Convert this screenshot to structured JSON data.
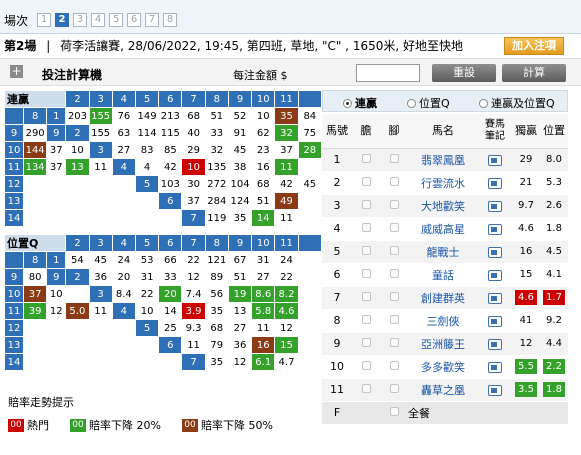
{
  "race_nav": {
    "label": "場次",
    "races": [
      "1",
      "2",
      "3",
      "4",
      "5",
      "6",
      "7",
      "8"
    ],
    "selected": "2"
  },
  "race_info": {
    "title": "第2場",
    "separator": "|",
    "details": "荷李活讓賽, 28/06/2022, 19:45, 第四班, 草地, \"C\" , 1650米, 好地至快地"
  },
  "add_button": "加入注項",
  "calc": {
    "title": "投注計算機",
    "amount_label": "每注金額 $",
    "amount_value": "",
    "reset": "重設",
    "compute": "計算"
  },
  "qin": {
    "corner": "連贏",
    "top_header": [
      "2",
      "3",
      "4",
      "5",
      "6",
      "7",
      "8",
      "9",
      "10",
      "11"
    ],
    "left_header": [
      "1",
      "2",
      "3",
      "4",
      "5",
      "6",
      "7",
      "8",
      "9",
      "10",
      "11",
      "12",
      "13",
      "14"
    ],
    "rows": [
      [
        "",
        "",
        "",
        "",
        "",
        "",
        "",
        "",
        "",
        "",
        ""
      ],
      [
        "203",
        "155",
        "76",
        "149",
        "213",
        "68",
        "51",
        "52",
        "10",
        "35",
        "84"
      ],
      [
        "290",
        "",
        "9",
        "2",
        "155",
        "63",
        "114",
        "115",
        "40",
        "33",
        "91"
      ],
      [
        "62",
        "",
        "",
        "",
        "32",
        "75",
        "",
        "",
        "",
        "",
        ""
      ],
      [
        "144",
        "37",
        "10",
        "",
        "3",
        "27",
        "83",
        "85",
        "29",
        "32",
        "45"
      ],
      [
        "23",
        "",
        "",
        "",
        "",
        "",
        "",
        "",
        "",
        "",
        ""
      ],
      [
        "134",
        "37",
        "13",
        "",
        "11",
        "",
        "4",
        "",
        "",
        "",
        ""
      ],
      [
        "",
        "",
        "",
        "",
        "",
        "",
        "",
        "",
        "",
        "",
        ""
      ]
    ],
    "display_rows": [
      {
        "label": "1",
        "cells": [
          {
            "v": "",
            "c": "dg"
          },
          {
            "v": "8",
            "c": "h"
          },
          {
            "v": "1",
            "c": "h"
          },
          {
            "v": "203",
            "c": ""
          },
          {
            "v": "155",
            "c": "g"
          },
          {
            "v": "76",
            "c": ""
          },
          {
            "v": "149",
            "c": ""
          },
          {
            "v": "213",
            "c": ""
          },
          {
            "v": "68",
            "c": ""
          },
          {
            "v": "51",
            "c": ""
          },
          {
            "v": "52",
            "c": ""
          },
          {
            "v": "10",
            "c": ""
          },
          {
            "v": "35",
            "c": "br"
          },
          {
            "v": "84",
            "c": ""
          }
        ]
      },
      {
        "label": "2",
        "cells": [
          {
            "v": "9",
            "c": "h"
          },
          {
            "v": "290",
            "c": ""
          },
          {
            "v": "9",
            "c": "h"
          },
          {
            "v": "2",
            "c": "h"
          },
          {
            "v": "155",
            "c": ""
          },
          {
            "v": "63",
            "c": ""
          },
          {
            "v": "114",
            "c": ""
          },
          {
            "v": "115",
            "c": ""
          },
          {
            "v": "40",
            "c": ""
          },
          {
            "v": "33",
            "c": ""
          },
          {
            "v": "91",
            "c": ""
          },
          {
            "v": "62",
            "c": ""
          },
          {
            "v": "32",
            "c": "g"
          },
          {
            "v": "75",
            "c": ""
          }
        ]
      },
      {
        "label": "3",
        "cells": [
          {
            "v": "10",
            "c": "h"
          },
          {
            "v": "144",
            "c": "br"
          },
          {
            "v": "37",
            "c": ""
          },
          {
            "v": "10",
            "c": ""
          },
          {
            "v": "3",
            "c": "h"
          },
          {
            "v": "27",
            "c": ""
          },
          {
            "v": "83",
            "c": ""
          },
          {
            "v": "85",
            "c": ""
          },
          {
            "v": "29",
            "c": ""
          },
          {
            "v": "32",
            "c": ""
          },
          {
            "v": "45",
            "c": ""
          },
          {
            "v": "23",
            "c": ""
          },
          {
            "v": "37",
            "c": ""
          },
          {
            "v": "28",
            "c": "g"
          }
        ]
      },
      {
        "label": "4",
        "cells": [
          {
            "v": "11",
            "c": "h"
          },
          {
            "v": "134",
            "c": "g"
          },
          {
            "v": "37",
            "c": ""
          },
          {
            "v": "13",
            "c": "g"
          },
          {
            "v": "11",
            "c": ""
          },
          {
            "v": "4",
            "c": "h"
          },
          {
            "v": "4",
            "c": ""
          },
          {
            "v": "42",
            "c": ""
          },
          {
            "v": "10",
            "c": "r"
          },
          {
            "v": "135",
            "c": ""
          },
          {
            "v": "38",
            "c": ""
          },
          {
            "v": "16",
            "c": ""
          },
          {
            "v": "11",
            "c": "g"
          },
          {
            "v": "",
            "c": ""
          }
        ]
      },
      {
        "label": "5",
        "cells": [
          {
            "v": "12",
            "c": "h"
          },
          {
            "v": "",
            "c": ""
          },
          {
            "v": "",
            "c": ""
          },
          {
            "v": "",
            "c": ""
          },
          {
            "v": "",
            "c": ""
          },
          {
            "v": "",
            "c": ""
          },
          {
            "v": "5",
            "c": "h"
          },
          {
            "v": "103",
            "c": ""
          },
          {
            "v": "30",
            "c": ""
          },
          {
            "v": "272",
            "c": ""
          },
          {
            "v": "104",
            "c": ""
          },
          {
            "v": "68",
            "c": ""
          },
          {
            "v": "42",
            "c": ""
          },
          {
            "v": "45",
            "c": ""
          }
        ]
      },
      {
        "label": "6",
        "cells": [
          {
            "v": "13",
            "c": "h"
          },
          {
            "v": "",
            "c": ""
          },
          {
            "v": "",
            "c": ""
          },
          {
            "v": "",
            "c": ""
          },
          {
            "v": "",
            "c": ""
          },
          {
            "v": "",
            "c": ""
          },
          {
            "v": "",
            "c": ""
          },
          {
            "v": "6",
            "c": "h"
          },
          {
            "v": "37",
            "c": ""
          },
          {
            "v": "284",
            "c": ""
          },
          {
            "v": "124",
            "c": ""
          },
          {
            "v": "51",
            "c": ""
          },
          {
            "v": "49",
            "c": "br"
          },
          {
            "v": "",
            "c": ""
          }
        ]
      },
      {
        "label": "7",
        "cells": [
          {
            "v": "14",
            "c": "h"
          },
          {
            "v": "",
            "c": ""
          },
          {
            "v": "",
            "c": ""
          },
          {
            "v": "",
            "c": ""
          },
          {
            "v": "",
            "c": ""
          },
          {
            "v": "",
            "c": ""
          },
          {
            "v": "",
            "c": ""
          },
          {
            "v": "",
            "c": ""
          },
          {
            "v": "7",
            "c": "h"
          },
          {
            "v": "119",
            "c": ""
          },
          {
            "v": "35",
            "c": ""
          },
          {
            "v": "14",
            "c": "g"
          },
          {
            "v": "11",
            "c": ""
          },
          {
            "v": "",
            "c": ""
          }
        ]
      }
    ]
  },
  "pos": {
    "corner": "位置Q",
    "display_rows": [
      {
        "cells": [
          {
            "v": "",
            "c": "dg"
          },
          {
            "v": "8",
            "c": "h"
          },
          {
            "v": "1",
            "c": "h"
          },
          {
            "v": "54",
            "c": ""
          },
          {
            "v": "45",
            "c": ""
          },
          {
            "v": "24",
            "c": ""
          },
          {
            "v": "53",
            "c": ""
          },
          {
            "v": "66",
            "c": ""
          },
          {
            "v": "22",
            "c": ""
          },
          {
            "v": "121",
            "c": ""
          },
          {
            "v": "67",
            "c": ""
          },
          {
            "v": "31",
            "c": ""
          },
          {
            "v": "24",
            "c": ""
          },
          {
            "v": "",
            "c": ""
          }
        ]
      },
      {
        "cells": [
          {
            "v": "9",
            "c": "h"
          },
          {
            "v": "80",
            "c": ""
          },
          {
            "v": "9",
            "c": "h"
          },
          {
            "v": "2",
            "c": "h"
          },
          {
            "v": "36",
            "c": ""
          },
          {
            "v": "20",
            "c": ""
          },
          {
            "v": "31",
            "c": ""
          },
          {
            "v": "33",
            "c": ""
          },
          {
            "v": "12",
            "c": ""
          },
          {
            "v": "89",
            "c": ""
          },
          {
            "v": "51",
            "c": ""
          },
          {
            "v": "27",
            "c": ""
          },
          {
            "v": "22",
            "c": ""
          },
          {
            "v": "",
            "c": ""
          }
        ]
      },
      {
        "cells": [
          {
            "v": "10",
            "c": "h"
          },
          {
            "v": "37",
            "c": "br"
          },
          {
            "v": "10",
            "c": ""
          },
          {
            "v": "",
            "c": ""
          },
          {
            "v": "3",
            "c": "h"
          },
          {
            "v": "8.4",
            "c": ""
          },
          {
            "v": "22",
            "c": ""
          },
          {
            "v": "20",
            "c": "g"
          },
          {
            "v": "7.4",
            "c": ""
          },
          {
            "v": "56",
            "c": ""
          },
          {
            "v": "19",
            "c": "g"
          },
          {
            "v": "8.6",
            "c": "g"
          },
          {
            "v": "8.2",
            "c": "g"
          },
          {
            "v": "",
            "c": ""
          }
        ]
      },
      {
        "cells": [
          {
            "v": "11",
            "c": "h"
          },
          {
            "v": "39",
            "c": "g"
          },
          {
            "v": "12",
            "c": ""
          },
          {
            "v": "5.0",
            "c": "br"
          },
          {
            "v": "11",
            "c": ""
          },
          {
            "v": "4",
            "c": "h"
          },
          {
            "v": "10",
            "c": ""
          },
          {
            "v": "14",
            "c": ""
          },
          {
            "v": "3.9",
            "c": "r"
          },
          {
            "v": "35",
            "c": ""
          },
          {
            "v": "13",
            "c": ""
          },
          {
            "v": "5.8",
            "c": "g"
          },
          {
            "v": "4.6",
            "c": "g"
          },
          {
            "v": "",
            "c": ""
          }
        ]
      },
      {
        "cells": [
          {
            "v": "12",
            "c": "h"
          },
          {
            "v": "",
            "c": ""
          },
          {
            "v": "",
            "c": ""
          },
          {
            "v": "",
            "c": ""
          },
          {
            "v": "",
            "c": ""
          },
          {
            "v": "",
            "c": ""
          },
          {
            "v": "5",
            "c": "h"
          },
          {
            "v": "25",
            "c": ""
          },
          {
            "v": "9.3",
            "c": ""
          },
          {
            "v": "68",
            "c": ""
          },
          {
            "v": "27",
            "c": ""
          },
          {
            "v": "11",
            "c": ""
          },
          {
            "v": "12",
            "c": ""
          },
          {
            "v": "",
            "c": ""
          }
        ]
      },
      {
        "cells": [
          {
            "v": "13",
            "c": "h"
          },
          {
            "v": "",
            "c": ""
          },
          {
            "v": "",
            "c": ""
          },
          {
            "v": "",
            "c": ""
          },
          {
            "v": "",
            "c": ""
          },
          {
            "v": "",
            "c": ""
          },
          {
            "v": "",
            "c": ""
          },
          {
            "v": "6",
            "c": "h"
          },
          {
            "v": "11",
            "c": ""
          },
          {
            "v": "79",
            "c": ""
          },
          {
            "v": "36",
            "c": ""
          },
          {
            "v": "16",
            "c": "br"
          },
          {
            "v": "15",
            "c": "g"
          },
          {
            "v": "",
            "c": ""
          }
        ]
      },
      {
        "cells": [
          {
            "v": "14",
            "c": "h"
          },
          {
            "v": "",
            "c": ""
          },
          {
            "v": "",
            "c": ""
          },
          {
            "v": "",
            "c": ""
          },
          {
            "v": "",
            "c": ""
          },
          {
            "v": "",
            "c": ""
          },
          {
            "v": "",
            "c": ""
          },
          {
            "v": "",
            "c": ""
          },
          {
            "v": "7",
            "c": "h"
          },
          {
            "v": "35",
            "c": ""
          },
          {
            "v": "12",
            "c": ""
          },
          {
            "v": "6.1",
            "c": "g"
          },
          {
            "v": "4.7",
            "c": ""
          },
          {
            "v": "",
            "c": ""
          }
        ]
      }
    ]
  },
  "hint": {
    "title": "賠率走勢提示",
    "items": [
      {
        "tag": "00",
        "label": "熱門",
        "c": "r"
      },
      {
        "tag": "00",
        "label": "賠率下降 20%",
        "c": "g"
      },
      {
        "tag": "00",
        "label": "賠率下降 50%",
        "c": "br"
      }
    ]
  },
  "tabs": [
    "連贏",
    "位置Q",
    "連贏及位置Q"
  ],
  "horses": {
    "headers": [
      "馬號",
      "膽",
      "腳",
      "馬名",
      "賽馬筆記",
      "獨贏",
      "位置"
    ],
    "rows": [
      {
        "no": "1",
        "name": "翡翠鳳凰",
        "win": "29",
        "place": "8.0",
        "wc": "",
        "pc": ""
      },
      {
        "no": "2",
        "name": "行雲流水",
        "win": "21",
        "place": "5.3",
        "wc": "",
        "pc": ""
      },
      {
        "no": "3",
        "name": "大地歡笑",
        "win": "9.7",
        "place": "2.6",
        "wc": "",
        "pc": ""
      },
      {
        "no": "4",
        "name": "威威高星",
        "win": "4.6",
        "place": "1.8",
        "wc": "",
        "pc": ""
      },
      {
        "no": "5",
        "name": "龍戰士",
        "win": "16",
        "place": "4.5",
        "wc": "",
        "pc": ""
      },
      {
        "no": "6",
        "name": "童話",
        "win": "15",
        "place": "4.1",
        "wc": "",
        "pc": ""
      },
      {
        "no": "7",
        "name": "創建群英",
        "win": "4.6",
        "place": "1.7",
        "wc": "r",
        "pc": "r"
      },
      {
        "no": "8",
        "name": "三劍俠",
        "win": "41",
        "place": "9.2",
        "wc": "",
        "pc": ""
      },
      {
        "no": "9",
        "name": "亞洲籐王",
        "win": "12",
        "place": "4.4",
        "wc": "",
        "pc": ""
      },
      {
        "no": "10",
        "name": "多多歡笑",
        "win": "5.5",
        "place": "2.2",
        "wc": "g",
        "pc": "g"
      },
      {
        "no": "11",
        "name": "轟草之凰",
        "win": "3.5",
        "place": "1.8",
        "wc": "g",
        "pc": "g"
      }
    ],
    "field": {
      "no": "F",
      "label": "全餐"
    }
  }
}
